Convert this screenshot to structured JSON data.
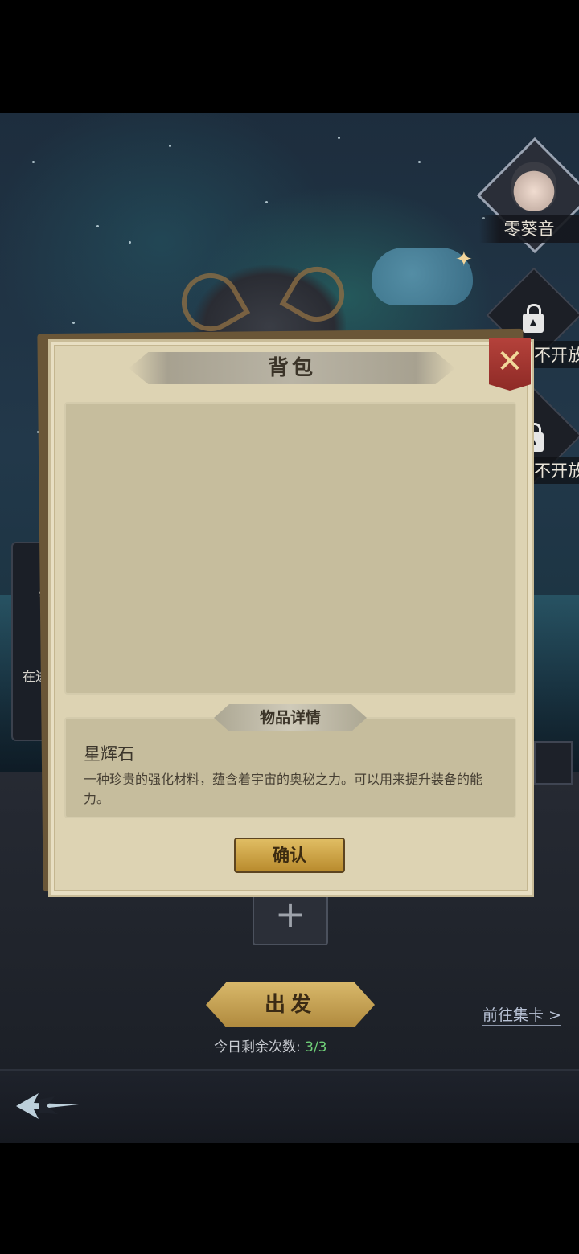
{
  "map": {
    "character_name": "零葵音",
    "locked_label_1": "不开放",
    "locked_label_2": "不开放",
    "left_text_1": "智",
    "left_text_2": "在进"
  },
  "modal": {
    "title": "背包",
    "close_icon": "close-x-icon",
    "detail_tab": "物品详情",
    "item_name": "星辉石",
    "item_description": "一种珍贵的强化材料，蕴含着宇宙的奥秘之力。可以用来提升装备的能力。",
    "confirm_label": "确认"
  },
  "footer": {
    "depart_label": "出发",
    "attempts_label": "今日剩余次数:",
    "attempts_value": "3/3",
    "goto_label": "前往集卡 >"
  },
  "colors": {
    "panel": "#ddd3b3",
    "button_gold": "#d8b86a",
    "close_red": "#b5423b",
    "attempts_green": "#6fcf78"
  }
}
